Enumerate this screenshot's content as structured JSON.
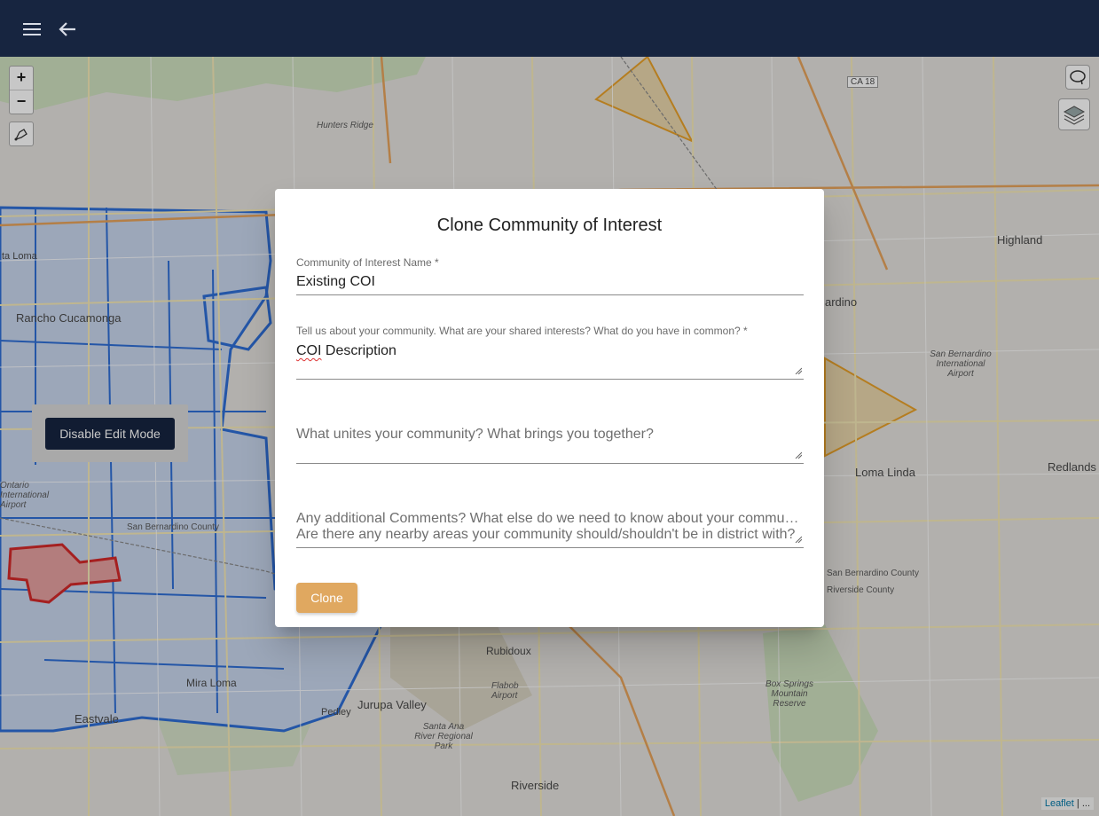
{
  "topbar": {
    "menu_icon": "menu-icon",
    "back_icon": "back-arrow-icon"
  },
  "map": {
    "zoom_in": "+",
    "zoom_out": "−",
    "draw_icon": "draw-polygon-icon",
    "lasso_icon": "lasso-icon",
    "layers_icon": "layers-icon",
    "edit_button_label": "Disable Edit Mode",
    "attribution_link": "Leaflet",
    "attribution_rest": " | ...",
    "places": {
      "rancho_cucamonga": "Rancho Cucamonga",
      "ta_loma": "ta Loma",
      "hunters_ridge": "Hunters Ridge",
      "highland": "Highland",
      "bernardino": "ardino",
      "sb_airport": "San Bernardino International Airport",
      "redlands": "Redlands",
      "loma_linda": "Loma Linda",
      "sb_county": "San Bernardino County",
      "riverside_county": "Riverside County",
      "ontario_airport": "Ontario International Airport",
      "sb_county_left": "San Bernardino County",
      "mira_loma": "Mira Loma",
      "eastvale": "Eastvale",
      "pedley": "Pedley",
      "jurupa_valley": "Jurupa Valley",
      "rubidoux": "Rubidoux",
      "flabob": "Flabob Airport",
      "santa_ana": "Santa Ana River Regional Park",
      "box_springs": "Box Springs Mountain Reserve",
      "riverside": "Riverside",
      "ca18": "CA 18"
    }
  },
  "dialog": {
    "title": "Clone Community of Interest",
    "name_label": "Community of Interest Name *",
    "name_value": "Existing COI",
    "desc_label": "Tell us about your community. What are your shared interests? What do you have in common? *",
    "desc_value_word1": "COI",
    "desc_value_word2": " Description",
    "unites_placeholder": "What unites your community? What brings you together?",
    "comments_placeholder_line1": "Any additional Comments? What else do we need to know about your commu…",
    "comments_placeholder_line2": "Are there any nearby areas your community should/shouldn't be in district with?",
    "clone_button": "Clone"
  },
  "colors": {
    "topbar": "#172540",
    "accent_button": "#e0a860",
    "district_blue": "#2f6fd6",
    "district_red": "#d42a2a",
    "district_orange": "#e8a12a"
  }
}
